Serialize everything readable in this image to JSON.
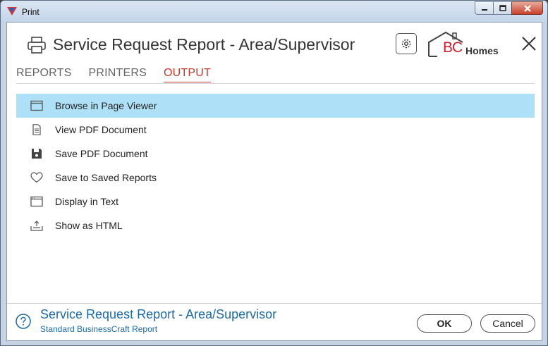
{
  "window": {
    "title": "Print"
  },
  "header": {
    "report_title": "Service Request Report - Area/Supervisor",
    "logo_prefix": "BC",
    "logo_suffix": "Homes"
  },
  "tabs": [
    {
      "label": "REPORTS",
      "active": false
    },
    {
      "label": "PRINTERS",
      "active": false
    },
    {
      "label": "OUTPUT",
      "active": true
    }
  ],
  "options": [
    {
      "label": "Browse in Page Viewer",
      "icon": "window-icon",
      "selected": true
    },
    {
      "label": "View PDF Document",
      "icon": "document-icon",
      "selected": false
    },
    {
      "label": "Save PDF Document",
      "icon": "floppy-disk-icon",
      "selected": false
    },
    {
      "label": "Save to Saved Reports",
      "icon": "heart-icon",
      "selected": false
    },
    {
      "label": "Display in Text",
      "icon": "text-window-icon",
      "selected": false
    },
    {
      "label": "Show as HTML",
      "icon": "export-tray-icon",
      "selected": false
    }
  ],
  "footer": {
    "title": "Service Request Report - Area/Supervisor",
    "subtitle": "Standard BusinessCraft Report",
    "ok_label": "OK",
    "cancel_label": "Cancel"
  },
  "colors": {
    "accent_tab": "#c0392b",
    "selection": "#aee1f7",
    "footer_text": "#1f6aa5",
    "logo_red": "#cc1e2a"
  }
}
